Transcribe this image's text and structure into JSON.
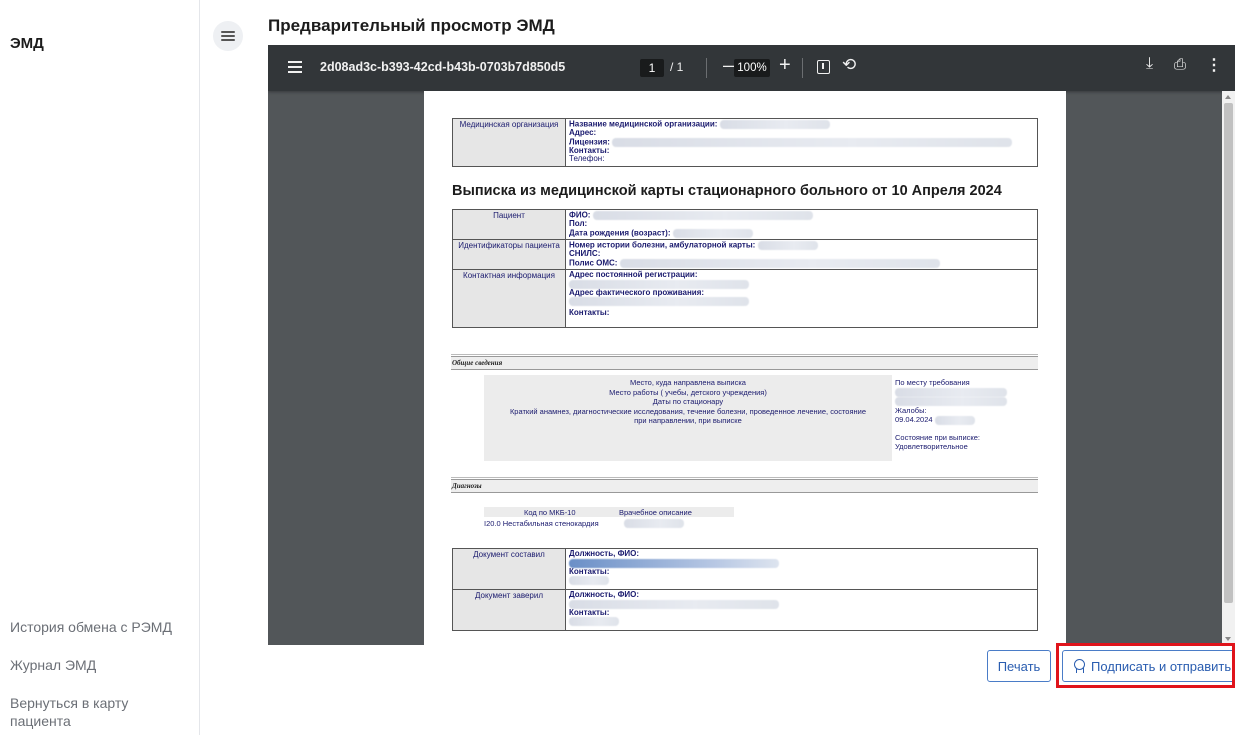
{
  "sidebar": {
    "title": "ЭМД",
    "links": [
      {
        "label": "История обмена с РЭМД"
      },
      {
        "label": "Журнал ЭМД"
      },
      {
        "label": "Вернуться в карту пациента"
      }
    ]
  },
  "page_title": "Предварительный просмотр ЭМД",
  "viewer": {
    "filename": "2d08ad3c-b393-42cd-b43b-0703b7d850d5",
    "page_current": "1",
    "page_total": "/ 1",
    "zoom": "100%",
    "icons": [
      "menu-icon",
      "zoom-out-icon",
      "zoom-in-icon",
      "fit-page-icon",
      "rotate-icon",
      "download-icon",
      "print-icon",
      "more-icon"
    ]
  },
  "document": {
    "org": {
      "label": "Медицинская организация",
      "fields": [
        "Название медицинской организации:",
        "Адрес:",
        "Лицензия:",
        "Контакты:",
        "Телефон:"
      ]
    },
    "heading": "Выписка из медицинской карты стационарного больного от 10 Апреля 2024",
    "patient": {
      "label": "Пациент",
      "fields": [
        "ФИО:",
        "Пол:",
        "Дата рождения (возраст):"
      ]
    },
    "ids": {
      "label": "Идентификаторы пациента",
      "fields": [
        "Номер истории болезни, амбулаторной карты:",
        "СНИЛС:",
        "Полис ОМС:"
      ]
    },
    "contacts": {
      "label": "Контактная информация",
      "fields": [
        "Адрес постоянной регистрации:",
        "Адрес фактического проживания:",
        "Контакты:"
      ]
    },
    "general_section": "Общие сведения",
    "general": {
      "left_lines": [
        "Место, куда направлена выписка",
        "Место работы ( учебы, детского учреждения)",
        "Даты по стационару",
        "Краткий анамнез, диагностические исследования, течение болезни, проведенное лечение, состояние",
        "при направлении, при выписке"
      ],
      "right_place": "По месту требования",
      "right_complaints_label": "Жалобы:",
      "right_complaints_date": "09.04.2024",
      "right_state_label": "Состояние при выписке:",
      "right_state_value": "Удовлетворительное"
    },
    "diag_section": "Диагнозы",
    "diag": {
      "col_code": "Код по МКБ-10",
      "col_desc": "Врачебное описание",
      "row": "I20.0 Нестабильная стенокардия"
    },
    "composed": {
      "label": "Документ составил",
      "fields": [
        "Должность, ФИО:",
        "Контакты:"
      ]
    },
    "certified": {
      "label": "Документ заверил",
      "fields": [
        "Должность, ФИО:",
        "Контакты:"
      ]
    }
  },
  "actions": {
    "print_label": "Печать",
    "sign_label": "Подписать и отправить"
  },
  "colors": {
    "accent": "#2a5db0",
    "highlight": "#e0141b",
    "viewer_bg": "#525659",
    "toolbar_bg": "#323639"
  }
}
